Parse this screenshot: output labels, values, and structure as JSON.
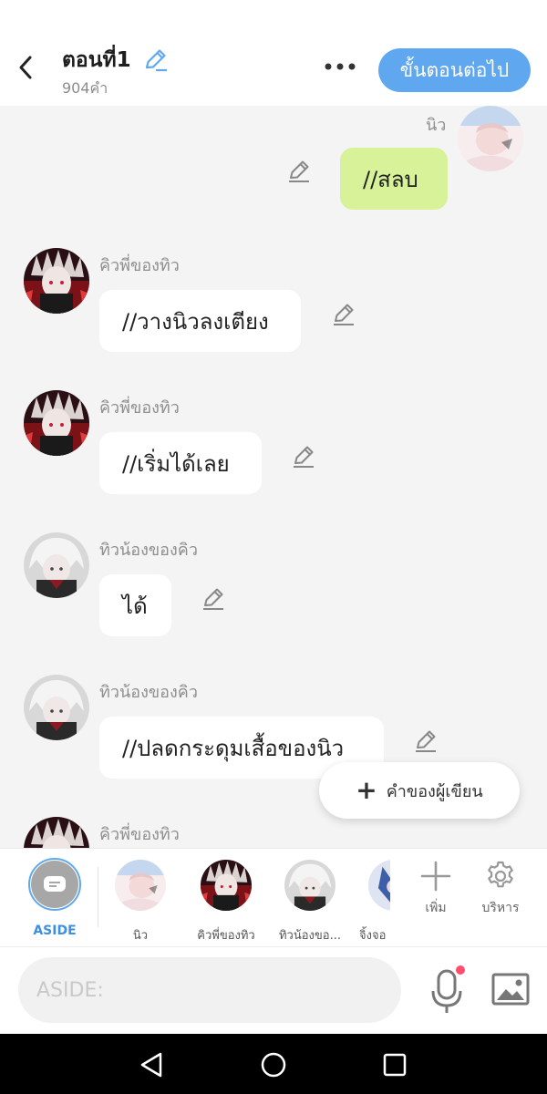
{
  "header": {
    "title": "ตอนที่1",
    "word_count": "904คำ",
    "next_button": "ขั้นตอนต่อไป"
  },
  "messages": [
    {
      "sender": "นิว",
      "text": "//สลบ",
      "mine": true,
      "avatar": "niw"
    },
    {
      "sender": "คิวพี่ของทิว",
      "text": "//วางนิวลงเตียง",
      "mine": false,
      "avatar": "kiw"
    },
    {
      "sender": "คิวพี่ของทิว",
      "text": "//เริ่มได้เลย",
      "mine": false,
      "avatar": "kiw"
    },
    {
      "sender": "ทิวน้องของคิว",
      "text": "ได้",
      "mine": false,
      "avatar": "tiw"
    },
    {
      "sender": "ทิวน้องของคิว",
      "text": "//ปลดกระดุมเสื้อของนิว",
      "mine": false,
      "avatar": "tiw"
    },
    {
      "sender": "คิวพี่ของทิว",
      "text": "",
      "mine": false,
      "avatar": "kiw"
    }
  ],
  "fab": {
    "label": "คำของผู้เขียน"
  },
  "characters": {
    "aside_label": "ASIDE",
    "items": [
      {
        "name": "นิว",
        "avatar": "niw"
      },
      {
        "name": "คิวพี่ของทิว",
        "avatar": "kiw"
      },
      {
        "name": "ทิวน้องขอ...",
        "avatar": "tiw"
      },
      {
        "name": "จิ้งจอ",
        "avatar": "fox"
      }
    ],
    "add_label": "เพิ่ม",
    "manage_label": "บริหาร"
  },
  "input": {
    "placeholder": "ASIDE:"
  },
  "colors": {
    "accent": "#5fa8ef",
    "my_bubble": "#d8f29a",
    "other_bubble": "#ffffff",
    "background": "#f4f4f4"
  },
  "icons": [
    "back-arrow-icon",
    "pencil-icon",
    "more-icon",
    "plus-icon",
    "gear-icon",
    "microphone-icon",
    "image-icon",
    "nav-back-icon",
    "nav-home-icon",
    "nav-recents-icon"
  ]
}
